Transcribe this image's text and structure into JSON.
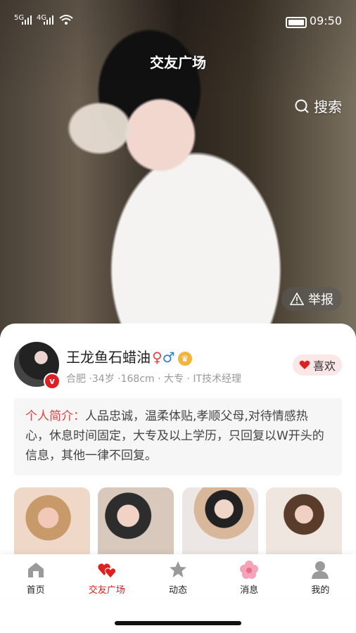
{
  "status_bar": {
    "signal1": "5G",
    "signal2": "4G",
    "time": "09:50"
  },
  "header": {
    "title": "交友广场",
    "search_label": "搜索",
    "report_label": "举报"
  },
  "profile": {
    "name": "王龙鱼石蜡油",
    "gender_symbols": "♀♂",
    "meta": "合肥 ·34岁 ·168cm · 大专 · IT技术经理",
    "like_label": "喜欢",
    "bio_label": "个人简介：",
    "bio_text": "人品忠诚，温柔体贴,孝顺父母,对待情感热心，休息时间固定，大专及以上学历，只回复以W开头的信息，其他一律不回复。"
  },
  "tabbar": {
    "items": [
      {
        "label": "首页",
        "icon": "home-icon"
      },
      {
        "label": "交友广场",
        "icon": "hearts-icon"
      },
      {
        "label": "动态",
        "icon": "star-icon"
      },
      {
        "label": "消息",
        "icon": "flower-icon"
      },
      {
        "label": "我的",
        "icon": "user-icon"
      }
    ]
  },
  "colors": {
    "accent": "#e02020",
    "bio_label": "#e24444",
    "like_bg": "#fbe6e8"
  }
}
